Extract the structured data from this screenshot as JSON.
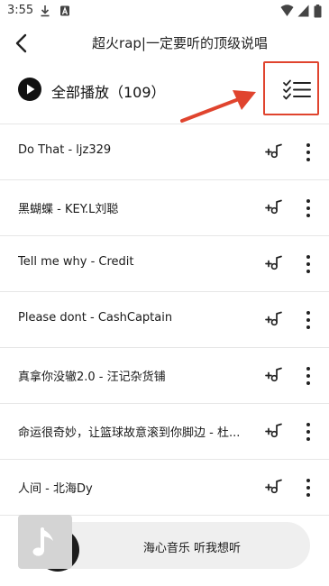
{
  "status_bar": {
    "time": "3:55",
    "left_icons": [
      "download-icon",
      "a-box-icon"
    ],
    "right_icons": [
      "wifi-icon",
      "cell-signal-icon",
      "battery-icon"
    ]
  },
  "header": {
    "title": "超火rap|一定要听的顶级说唱",
    "back_icon": "back-arrow-icon"
  },
  "play_all": {
    "label": "全部播放（109）",
    "play_icon": "play-icon",
    "multiselect_icon": "checklist-icon"
  },
  "songs": [
    {
      "title": "Do That - ljz329"
    },
    {
      "title": "黑蝴蝶 - KEY.L刘聪"
    },
    {
      "title": "Tell me why - Credit"
    },
    {
      "title": "Please dont - CashCaptain"
    },
    {
      "title": "真拿你没辙2.0 - 汪记杂货铺"
    },
    {
      "title": "命运很奇妙，让篮球故意滚到你脚边 - 杜..."
    },
    {
      "title": "人间 - 北海Dy"
    }
  ],
  "player": {
    "text": "海心音乐 听我想听",
    "art_icon": "music-note-icon"
  },
  "colors": {
    "accent_red": "#e0442e",
    "text": "#1a1a1a",
    "divider": "#e6e6e6"
  }
}
